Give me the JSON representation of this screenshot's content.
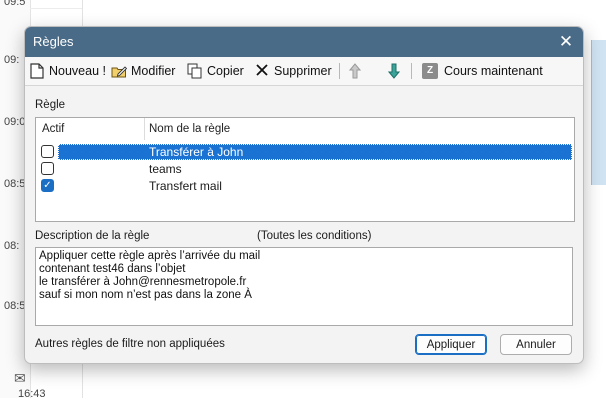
{
  "background": {
    "times": [
      "09:5",
      "09:",
      "09:0",
      "08:5",
      "08:",
      "08:5",
      "16:43"
    ]
  },
  "dialog": {
    "title": "Règles",
    "close_glyph": "✕",
    "toolbar": {
      "new_label": "Nouveau !",
      "modify_label": "Modifier",
      "copy_label": "Copier",
      "delete_label": "Supprimer",
      "run_now_label": "Cours maintenant",
      "run_now_icon_text": "Z"
    },
    "rules_section_label": "Règle",
    "rules_list": {
      "col_active": "Actif",
      "col_name": "Nom de la règle",
      "rows": [
        {
          "name": "Transférer à John",
          "checked": false,
          "selected": true
        },
        {
          "name": "teams",
          "checked": false,
          "selected": false
        },
        {
          "name": "Transfert mail",
          "checked": true,
          "selected": false
        }
      ]
    },
    "description_label": "Description de la règle",
    "conditions_label": "(Toutes les conditions)",
    "description_lines": [
      "Appliquer cette règle après l’arrivée du mail",
      "contenant test46 dans l’objet",
      "le transférer à John@rennesmetropole.fr",
      "sauf si mon nom n’est pas dans la zone À"
    ],
    "footer_text": "Autres règles de filtre non appliquées",
    "apply_label": "Appliquer",
    "cancel_label": "Annuler"
  },
  "colors": {
    "titlebar": "#4a6b87",
    "selection": "#1a73d3",
    "checkbox_checked": "#1a6fc4"
  }
}
